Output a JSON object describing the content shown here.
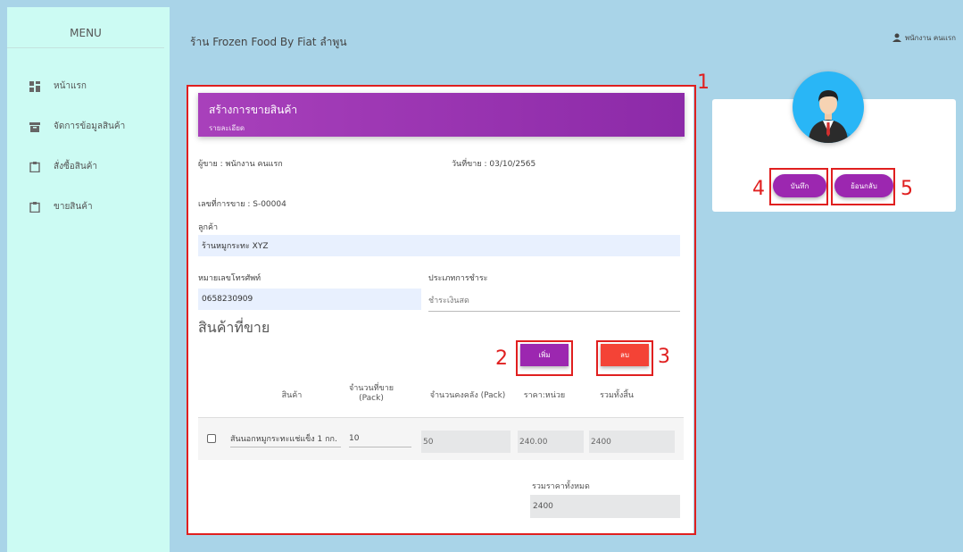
{
  "sidebar": {
    "title": "MENU",
    "items": [
      {
        "label": "หน้าแรก",
        "icon": "dashboard-icon"
      },
      {
        "label": "จัดการข้อมูลสินค้า",
        "icon": "archive-icon"
      },
      {
        "label": "สั่งซื้อสินค้า",
        "icon": "clipboard-icon"
      },
      {
        "label": "ขายสินค้า",
        "icon": "clipboard-icon"
      }
    ]
  },
  "header": {
    "shop_title": "ร้าน Frozen Food By Fiat ลำพูน",
    "user_name": "พนักงาน คนแรก"
  },
  "card": {
    "title": "สร้างการขายสินค้า",
    "subtitle": "รายละเอียด"
  },
  "form": {
    "seller": "ผู้ขาย : พนักงาน คนแรก",
    "sale_date": "วันที่ขาย : 03/10/2565",
    "sale_no": "เลขที่การขาย : S-00004",
    "customer_label": "ลูกค้า",
    "customer_value": "ร้านหมูกระทะ XYZ",
    "phone_label": "หมายเลขโทรศัพท์",
    "phone_value": "0658230909",
    "payment_label": "ประเภทการชำระ",
    "payment_value": "ชำระเงินสด"
  },
  "products": {
    "section_title": "สินค้าที่ขาย",
    "add_label": "เพิ่ม",
    "delete_label": "ลบ",
    "headers": [
      "สินค้า",
      "จำนวนที่ขาย",
      "(Pack)",
      "จำนวนคงคลัง (Pack)",
      "ราคา:หน่วย",
      "รวมทั้งสิ้น"
    ],
    "rows": [
      {
        "name": "สันนอกหมูกระทะแช่แข็ง 1 กก.",
        "qty": "10",
        "stock": "50",
        "price": "240.00",
        "total": "2400"
      }
    ],
    "grand_total_label": "รวมราคาทั้งหมด",
    "grand_total_value": "2400"
  },
  "actions": {
    "save_label": "บันทึก",
    "back_label": "ย้อนกลับ"
  },
  "annotations": [
    "1",
    "2",
    "3",
    "4",
    "5"
  ],
  "colors": {
    "accent": "#9c27b0",
    "danger": "#f44336",
    "annotation": "#e01f1f",
    "sidebar_bg": "#ccfbf3",
    "page_bg": "#a9d4e8"
  }
}
